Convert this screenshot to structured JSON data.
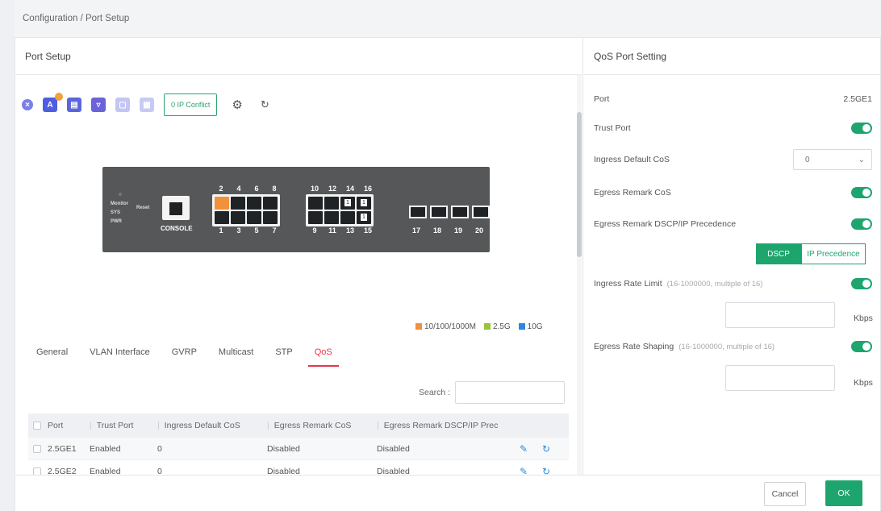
{
  "breadcrumb": "Configuration / Port Setup",
  "left_panel": {
    "title": "Port Setup"
  },
  "toolbar": {
    "tb1_letter": "A",
    "ip_conflict": "0 IP Conflict"
  },
  "switch": {
    "led_monitor": "Monitor",
    "led_sys": "SYS",
    "led_pwr": "PWR",
    "reset": "Reset",
    "console": "CONSOLE",
    "top_group1": [
      "2",
      "4",
      "6",
      "8"
    ],
    "top_group2": [
      "10",
      "12",
      "14",
      "16"
    ],
    "bottom_group1": [
      "1",
      "3",
      "5",
      "7"
    ],
    "bottom_group2": [
      "9",
      "11",
      "13",
      "15"
    ],
    "sfp_group": [
      "17",
      "18",
      "19",
      "20"
    ]
  },
  "legend": [
    {
      "label": "10/100/1000M",
      "color": "#f0923a"
    },
    {
      "label": "2.5G",
      "color": "#9ac43a"
    },
    {
      "label": "10G",
      "color": "#2f86e6"
    }
  ],
  "tabs": [
    "General",
    "VLAN Interface",
    "GVRP",
    "Multicast",
    "STP",
    "QoS"
  ],
  "search": {
    "label": "Search :"
  },
  "table": {
    "headers": [
      "Port",
      "Trust Port",
      "Ingress Default CoS",
      "Egress Remark CoS",
      "Egress Remark DSCP/IP Prec"
    ],
    "rows": [
      [
        "2.5GE1",
        "Enabled",
        "0",
        "Disabled",
        "Disabled"
      ],
      [
        "2.5GE2",
        "Enabled",
        "0",
        "Disabled",
        "Disabled"
      ]
    ]
  },
  "qos": {
    "title": "QoS Port Setting",
    "port_label": "Port",
    "port_value": "2.5GE1",
    "trust_port": "Trust Port",
    "ingress_default_cos": "Ingress Default CoS",
    "ingress_default_cos_value": "0",
    "egress_remark_cos": "Egress Remark CoS",
    "egress_remark_dscp": "Egress Remark DSCP/IP Precedence",
    "seg_dscp": "DSCP",
    "seg_ip": "IP Precedence",
    "ingress_rate_limit": "Ingress Rate Limit",
    "ingress_rate_hint": "(16-1000000, multiple of 16)",
    "egress_rate_shaping": "Egress Rate Shaping",
    "egress_rate_hint": "(16-1000000, multiple of 16)",
    "kbps": "Kbps"
  },
  "footer": {
    "cancel": "Cancel",
    "ok": "OK"
  }
}
